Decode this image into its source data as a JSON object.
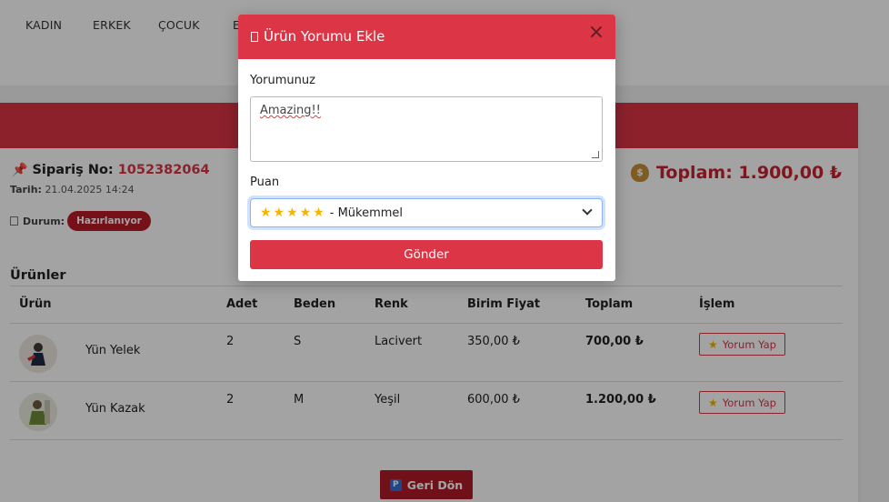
{
  "nav": {
    "items": [
      "KADIN",
      "ERKEK",
      "ÇOCUK",
      "E"
    ]
  },
  "order": {
    "label": "Sipariş No:",
    "number": "1052382064",
    "date_label": "Tarih:",
    "date": "21.04.2025 14:24",
    "status_label": "Durum:",
    "status": "Hazırlanıyor",
    "total": "Toplam: 1.900,00 ₺"
  },
  "products": {
    "title": "Ürünler",
    "headers": [
      "Ürün",
      "Adet",
      "Beden",
      "Renk",
      "Birim Fiyat",
      "Toplam",
      "İşlem"
    ],
    "rows": [
      {
        "name": "Yün Yelek",
        "qty": "2",
        "size": "S",
        "color": "Lacivert",
        "unit_price": "350,00 ₺",
        "total": "700,00 ₺",
        "action": "Yorum Yap"
      },
      {
        "name": "Yün Kazak",
        "qty": "2",
        "size": "M",
        "color": "Yeşil",
        "unit_price": "600,00 ₺",
        "total": "1.200,00 ₺",
        "action": "Yorum Yap"
      }
    ]
  },
  "back_button": "Geri Dön",
  "modal": {
    "title": "Ürün Yorumu Ekle",
    "comment_label": "Yorumunuz",
    "comment_value": "Amazing!!",
    "rating_label": "Puan",
    "rating_stars": "★★★★★",
    "rating_value": "- Mükemmel",
    "submit": "Gönder"
  },
  "colors": {
    "accent": "#dc3545",
    "badge": "#b91c28",
    "star": "#f4b400"
  }
}
